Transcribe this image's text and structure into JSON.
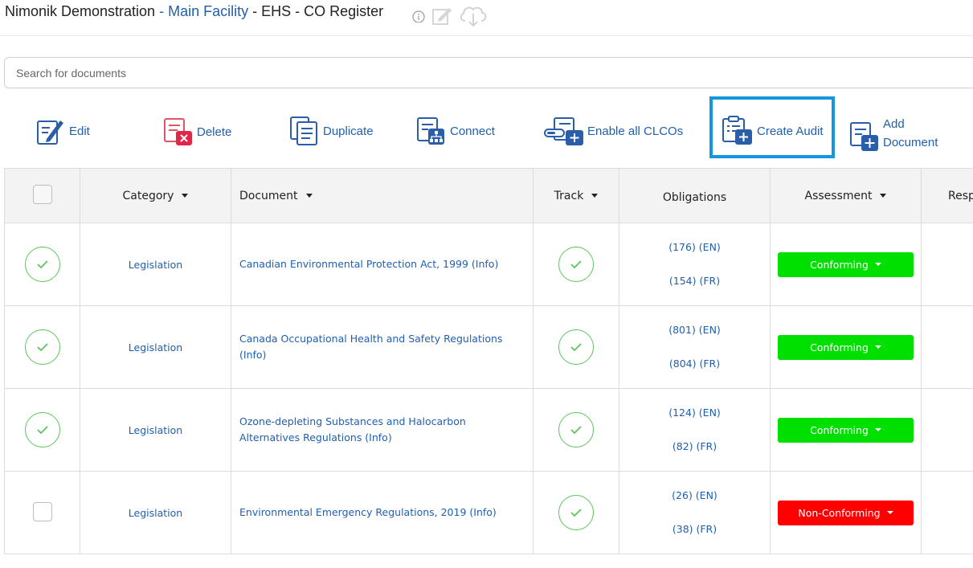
{
  "header": {
    "org": "Nimonik Demonstration",
    "sep1": " - ",
    "facility": "Main Facility",
    "sep2": " - ",
    "register": "EHS - CO Register"
  },
  "search": {
    "placeholder": "Search for documents"
  },
  "toolbar": {
    "edit": "Edit",
    "delete": "Delete",
    "duplicate": "Duplicate",
    "connect": "Connect",
    "enable_clcos": "Enable all CLCOs",
    "create_audit": "Create Audit",
    "add_document_1": "Add",
    "add_document_2": "Document"
  },
  "table": {
    "headers": {
      "category": "Category",
      "document": "Document",
      "track": "Track",
      "obligations": "Obligations",
      "assessment": "Assessment",
      "responsible": "Resp"
    },
    "rows": [
      {
        "category": "Legislation",
        "document": "Canadian Environmental Protection Act, 1999 (Info)",
        "obl_en": "(176) (EN)",
        "obl_fr": "(154) (FR)",
        "assessment": "Conforming",
        "selected": true
      },
      {
        "category": "Legislation",
        "document": "Canada Occupational Health and Safety Regulations (Info)",
        "obl_en": "(801) (EN)",
        "obl_fr": "(804) (FR)",
        "assessment": "Conforming",
        "selected": true
      },
      {
        "category": "Legislation",
        "document": "Ozone-depleting Substances and Halocarbon Alternatives Regulations (Info)",
        "obl_en": "(124) (EN)",
        "obl_fr": "(82) (FR)",
        "assessment": "Conforming",
        "selected": true
      },
      {
        "category": "Legislation",
        "document": "Environmental Emergency Regulations, 2019 (Info)",
        "obl_en": "(26) (EN)",
        "obl_fr": "(38) (FR)",
        "assessment": "Non-Conforming",
        "selected": false
      }
    ]
  },
  "colors": {
    "link": "#1f5fb0",
    "conforming": "#00e000",
    "non_conforming": "#ff0000",
    "check": "#5cc55c",
    "highlight": "#1696dc"
  }
}
